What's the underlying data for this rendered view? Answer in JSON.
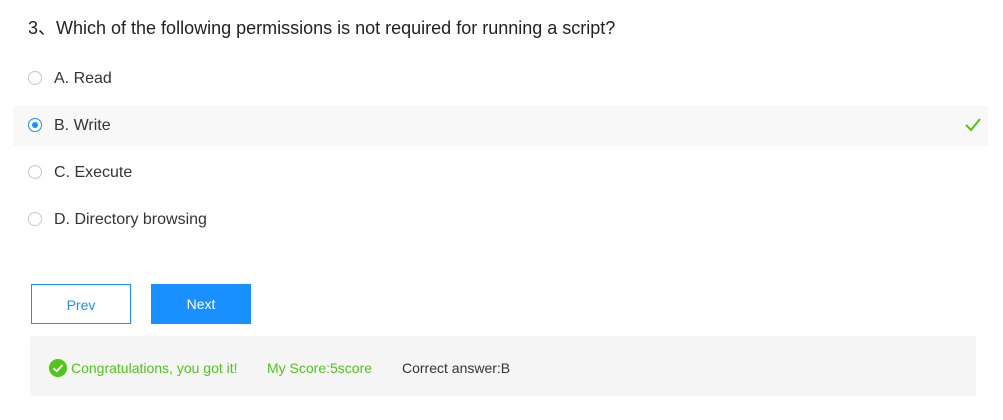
{
  "question": {
    "text": "3、Which of the following permissions is not required for running a script?"
  },
  "options": [
    {
      "label": "A. Read",
      "selected": false
    },
    {
      "label": "B. Write",
      "selected": true
    },
    {
      "label": "C. Execute",
      "selected": false
    },
    {
      "label": "D. Directory browsing",
      "selected": false
    }
  ],
  "buttons": {
    "prev_label": "Prev",
    "next_label": "Next"
  },
  "result": {
    "message": "Congratulations, you got it!",
    "score": "My Score:5score",
    "correct_answer": "Correct answer:B"
  },
  "colors": {
    "accent": "#1890ff",
    "success": "#52c41a"
  },
  "icons": {
    "correct": "check-icon",
    "success": "check-circle-icon"
  }
}
